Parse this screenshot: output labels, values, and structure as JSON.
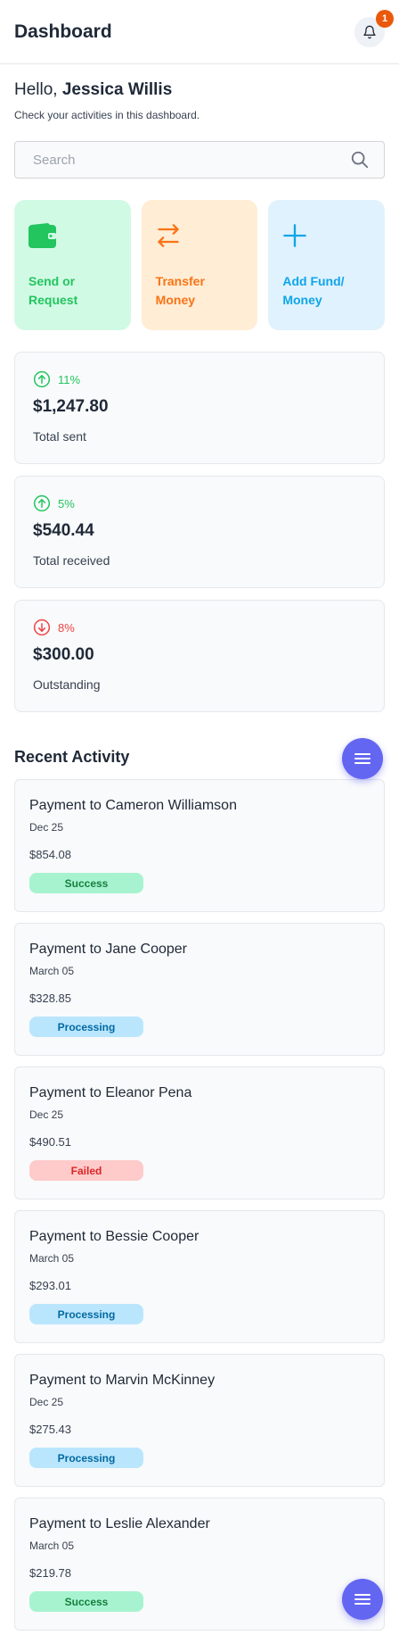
{
  "header": {
    "title": "Dashboard",
    "notification_count": "1"
  },
  "greeting": {
    "hello": "Hello, ",
    "name": "Jessica Willis",
    "subtitle": "Check your activities in this dashboard."
  },
  "search": {
    "placeholder": "Search"
  },
  "actions": [
    {
      "line1": "Send or",
      "line2": "Request",
      "icon": "wallet-icon"
    },
    {
      "line1": "Transfer",
      "line2": "Money",
      "icon": "transfer-arrows-icon"
    },
    {
      "line1": "Add Fund/",
      "line2": "Money",
      "icon": "plus-icon"
    }
  ],
  "stats": [
    {
      "pct": "11%",
      "amount": "$1,247.80",
      "label": "Total sent",
      "direction": "up",
      "color": "#22c55e"
    },
    {
      "pct": "5%",
      "amount": "$540.44",
      "label": "Total received",
      "direction": "up",
      "color": "#22c55e"
    },
    {
      "pct": "8%",
      "amount": "$300.00",
      "label": "Outstanding",
      "direction": "down",
      "color": "#ef4444"
    }
  ],
  "recent": {
    "title": "Recent Activity",
    "items": [
      {
        "title": "Payment to Cameron Williamson",
        "date": "Dec 25",
        "amount": "$854.08",
        "status": "Success"
      },
      {
        "title": "Payment to Jane Cooper",
        "date": "March 05",
        "amount": "$328.85",
        "status": "Processing"
      },
      {
        "title": "Payment to Eleanor Pena",
        "date": "Dec 25",
        "amount": "$490.51",
        "status": "Failed"
      },
      {
        "title": "Payment to Bessie Cooper",
        "date": "March 05",
        "amount": "$293.01",
        "status": "Processing"
      },
      {
        "title": "Payment to Marvin McKinney",
        "date": "Dec 25",
        "amount": "$275.43",
        "status": "Processing"
      },
      {
        "title": "Payment to Leslie Alexander",
        "date": "March 05",
        "amount": "$219.78",
        "status": "Success"
      }
    ]
  },
  "colors": {
    "accent": "#6366f1",
    "success": "#22c55e",
    "danger": "#ef4444",
    "badge": "#ea580c"
  }
}
